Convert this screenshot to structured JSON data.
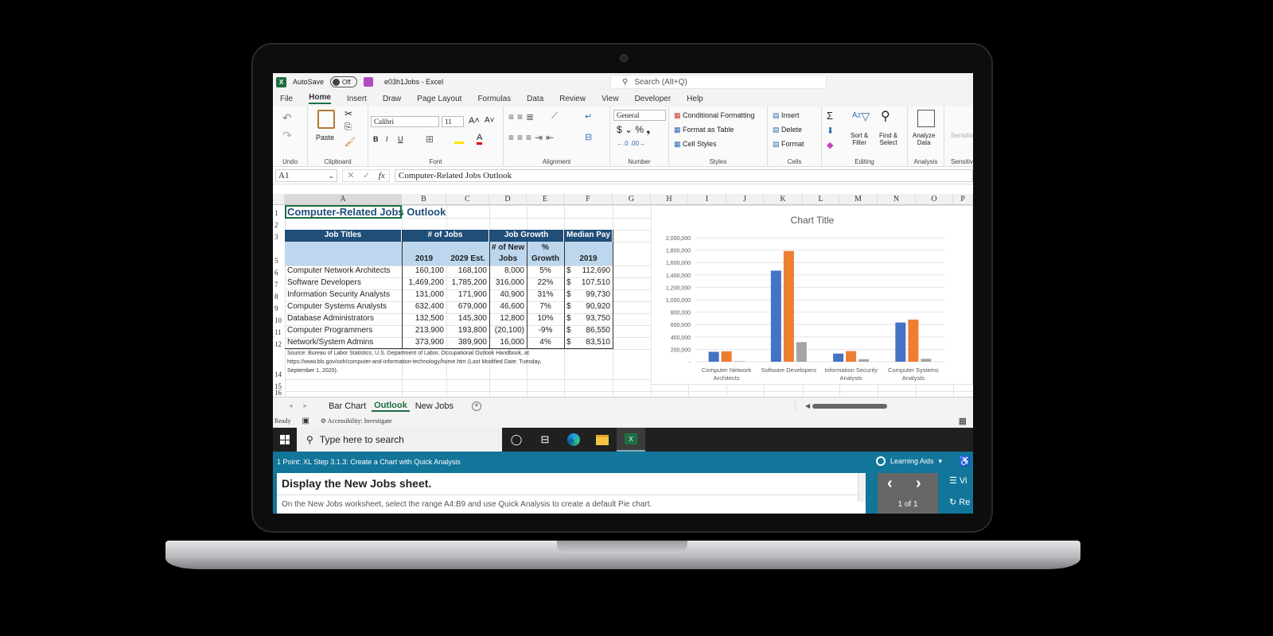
{
  "window": {
    "title": "e03h1Jobs - Excel",
    "autosave_label": "AutoSave",
    "autosave_state": "Off",
    "search_placeholder": "Search (Alt+Q)"
  },
  "menu": [
    "File",
    "Home",
    "Insert",
    "Draw",
    "Page Layout",
    "Formulas",
    "Data",
    "Review",
    "View",
    "Developer",
    "Help"
  ],
  "menu_active": "Home",
  "ribbon": {
    "groups": {
      "undo": "Undo",
      "clipboard": "Clipboard",
      "font": "Font",
      "alignment": "Alignment",
      "number": "Number",
      "styles": "Styles",
      "cells": "Cells",
      "editing": "Editing",
      "analysis": "Analysis",
      "sensitivity": "Sensitivity"
    },
    "paste": "Paste",
    "font_name": "Calibri",
    "font_size": "11",
    "number_format": "General",
    "conditional_formatting": "Conditional Formatting",
    "format_as_table": "Format as Table",
    "cell_styles": "Cell Styles",
    "insert": "Insert",
    "delete": "Delete",
    "format": "Format",
    "sort_filter_1": "Sort &",
    "sort_filter_2": "Filter",
    "find_select_1": "Find &",
    "find_select_2": "Select",
    "analyze_1": "Analyze",
    "analyze_2": "Data",
    "sensitivity_label": "Sensitivi"
  },
  "formula_bar": {
    "name_box": "A1",
    "formula": "Computer-Related Jobs Outlook"
  },
  "columns": [
    "A",
    "B",
    "C",
    "D",
    "E",
    "F",
    "G",
    "H",
    "I",
    "J",
    "K",
    "L",
    "M",
    "N",
    "O",
    "P"
  ],
  "sheet": {
    "title": "Computer-Related Jobs Outlook",
    "header_row3": {
      "job_titles": "Job Titles",
      "num_jobs": "# of Jobs",
      "job_growth": "Job Growth",
      "median_pay": "Median Pay"
    },
    "header_row5": {
      "b": "2019",
      "c": "2029 Est.",
      "d1": "# of New",
      "d2": "Jobs",
      "e1": "%",
      "e2": "Growth",
      "f": "2019"
    },
    "rows": [
      {
        "n": "6",
        "title": "Computer Network Architects",
        "y2019": "160,100",
        "y2029": "168,100",
        "new": "8,000",
        "pct": "5%",
        "pay": "112,690"
      },
      {
        "n": "7",
        "title": "Software Developers",
        "y2019": "1,469,200",
        "y2029": "1,785,200",
        "new": "316,000",
        "pct": "22%",
        "pay": "107,510"
      },
      {
        "n": "8",
        "title": "Information Security Analysts",
        "y2019": "131,000",
        "y2029": "171,900",
        "new": "40,900",
        "pct": "31%",
        "pay": "99,730"
      },
      {
        "n": "9",
        "title": "Computer Systems Analysts",
        "y2019": "632,400",
        "y2029": "679,000",
        "new": "46,600",
        "pct": "7%",
        "pay": "90,920"
      },
      {
        "n": "10",
        "title": "Database Administrators",
        "y2019": "132,500",
        "y2029": "145,300",
        "new": "12,800",
        "pct": "10%",
        "pay": "93,750"
      },
      {
        "n": "11",
        "title": "Computer Programmers",
        "y2019": "213,900",
        "y2029": "193,800",
        "new": "(20,100)",
        "pct": "-9%",
        "pay": "86,550"
      },
      {
        "n": "12",
        "title": "Network/System Admins",
        "y2019": "373,900",
        "y2029": "389,900",
        "new": "16,000",
        "pct": "4%",
        "pay": "83,510"
      }
    ],
    "currency_symbol": "$",
    "source_line1": "Source: Bureau of Labor Statistics, U.S. Department of Labor, Occupational Outlook Handbook,  at",
    "source_line2": "https://www.bls.gov/ooh/computer-and-information-technology/home.htm (Last Modified Date: Tuesday,",
    "source_line3": "September 1, 2020).",
    "row_numbers": [
      "1",
      "2",
      "3",
      "5",
      "14",
      "15",
      "16"
    ]
  },
  "chart_data": {
    "type": "bar",
    "title": "Chart Title",
    "categories": [
      "Computer Network Architects",
      "Software Developers",
      "Information Security Analysts",
      "Computer Systems Analysts"
    ],
    "series": [
      {
        "name": "2019",
        "color": "#4472c4",
        "values": [
          160100,
          1469200,
          131000,
          632400
        ]
      },
      {
        "name": "2029 Est.",
        "color": "#ed7d31",
        "values": [
          168100,
          1785200,
          171900,
          679000
        ]
      },
      {
        "name": "# of New Jobs",
        "color": "#a5a5a5",
        "values": [
          8000,
          316000,
          40900,
          46600
        ]
      }
    ],
    "ylim": [
      0,
      2000000
    ],
    "yticks": [
      "-",
      "200,000",
      "400,000",
      "600,000",
      "800,000",
      "1,000,000",
      "1,200,000",
      "1,400,000",
      "1,600,000",
      "1,800,000",
      "2,000,000"
    ],
    "xtick_labels": [
      [
        "Computer Network",
        "Architects"
      ],
      [
        "Software Developers",
        ""
      ],
      [
        "Information Security",
        "Analysts"
      ],
      [
        "Computer Systems",
        "Analysts"
      ]
    ],
    "grid": true,
    "legend": "none"
  },
  "sheet_tabs": [
    "Bar Chart",
    "Outlook",
    "New Jobs"
  ],
  "active_tab": "Outlook",
  "status": {
    "ready": "Ready",
    "accessibility": "Accessibility: Investigate"
  },
  "taskbar": {
    "search_placeholder": "Type here to search"
  },
  "lms": {
    "step": "1 Point: XL Step 3.1.3: Create a Chart with Quick Analysis",
    "learning_aids": "Learning Aids",
    "heading": "Display the New Jobs sheet.",
    "instruction": "On the New Jobs worksheet, select the range A4:B9 and use Quick Analysis to create a default Pie chart.",
    "pager": "1 of 1",
    "view_label": "Vi",
    "reset_label": "Re"
  }
}
